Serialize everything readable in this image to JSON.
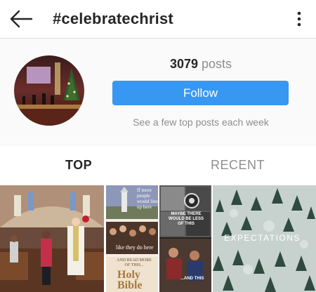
{
  "header": {
    "title": "#celebratechrist"
  },
  "profile": {
    "post_count": "3079",
    "post_label": "posts",
    "follow_label": "Follow",
    "hint": "See a few top posts each week"
  },
  "tabs": [
    {
      "label": "TOP",
      "active": true
    },
    {
      "label": "RECENT",
      "active": false
    }
  ],
  "posts": {
    "post1": {},
    "post2": {
      "caption_top": "If more people would line up here",
      "caption_mid": "like they do here",
      "caption_small": "AND READ MORE OF THIS...",
      "book": "Holy Bible"
    },
    "post3": {
      "caption_top": "MAYBE THERE WOULD BE LESS OF THIS",
      "caption_bottom": "...AND THIS"
    },
    "post4": {
      "word": "EXPECTATIONS"
    }
  },
  "colors": {
    "accent": "#3897f0",
    "text": "#262626",
    "muted": "#8e8e8e"
  },
  "icons": {
    "back": "back-arrow-icon",
    "more": "more-vertical-icon"
  }
}
